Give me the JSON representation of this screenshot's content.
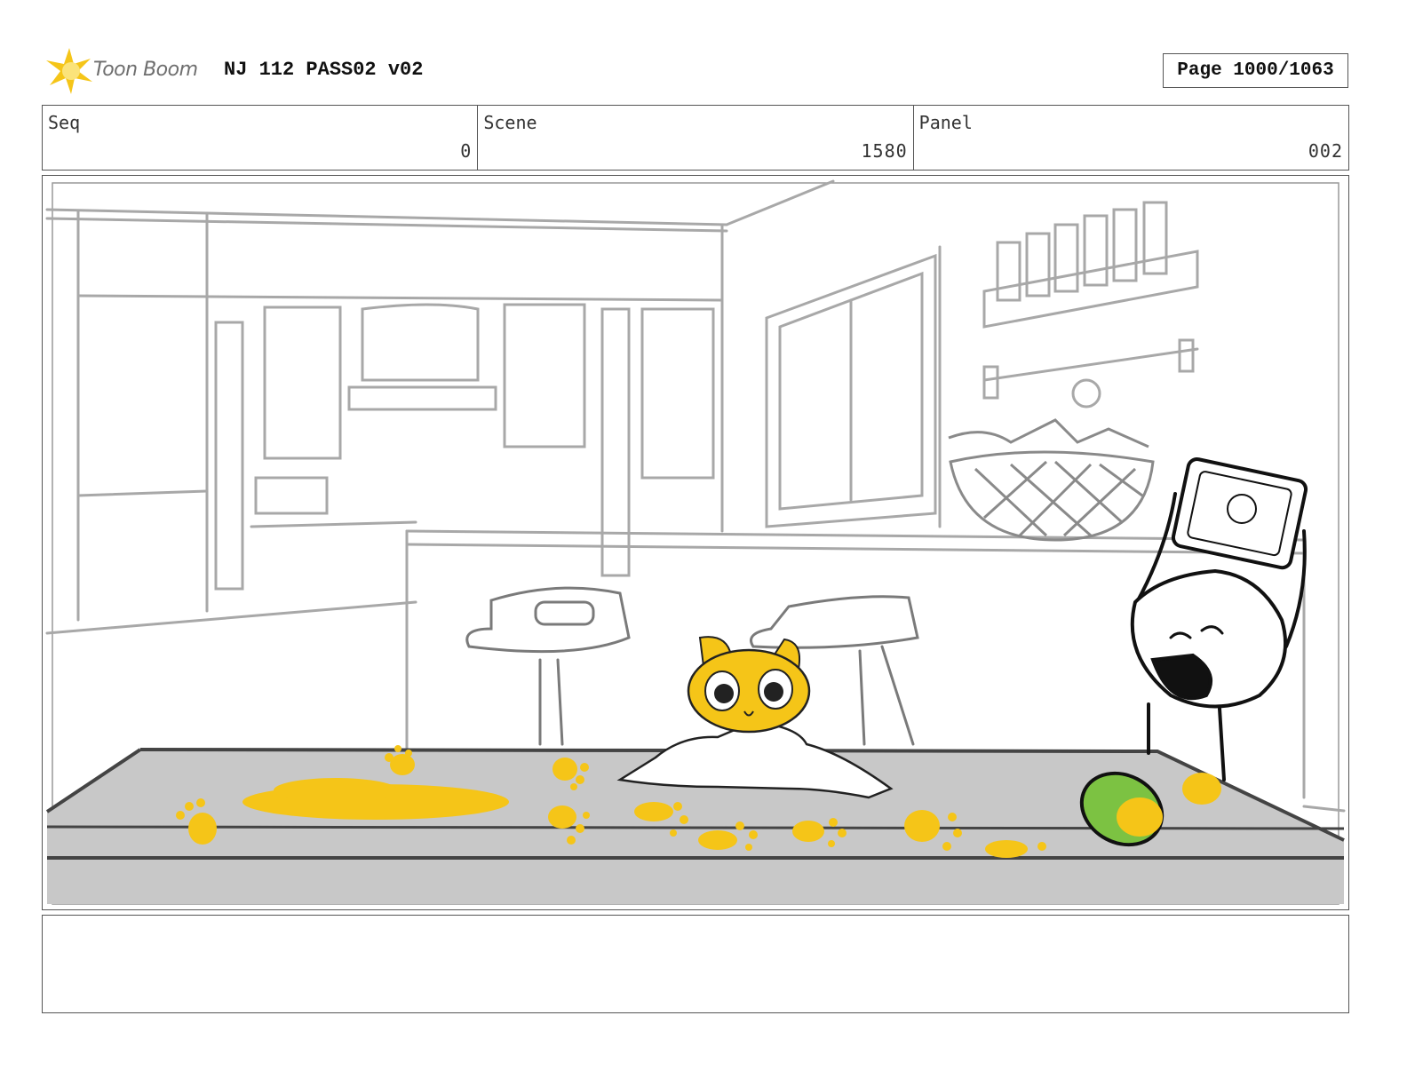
{
  "header": {
    "logo_text": "Toon Boom",
    "logo_icon": "toon-boom-star-icon",
    "title": "NJ 112 PASS02 v02",
    "page": "Page 1000/1063"
  },
  "fields": {
    "seq_label": "Seq",
    "seq_value": "0",
    "scene_label": "Scene",
    "scene_value": "1580",
    "panel_label": "Panel",
    "panel_value": "002"
  },
  "notes": {
    "text": ""
  },
  "colors": {
    "accent_yellow": "#f5c518",
    "mango_green": "#7cc242",
    "sketch_gray": "#9a9a9a",
    "table_gray": "#c8c8c8"
  }
}
